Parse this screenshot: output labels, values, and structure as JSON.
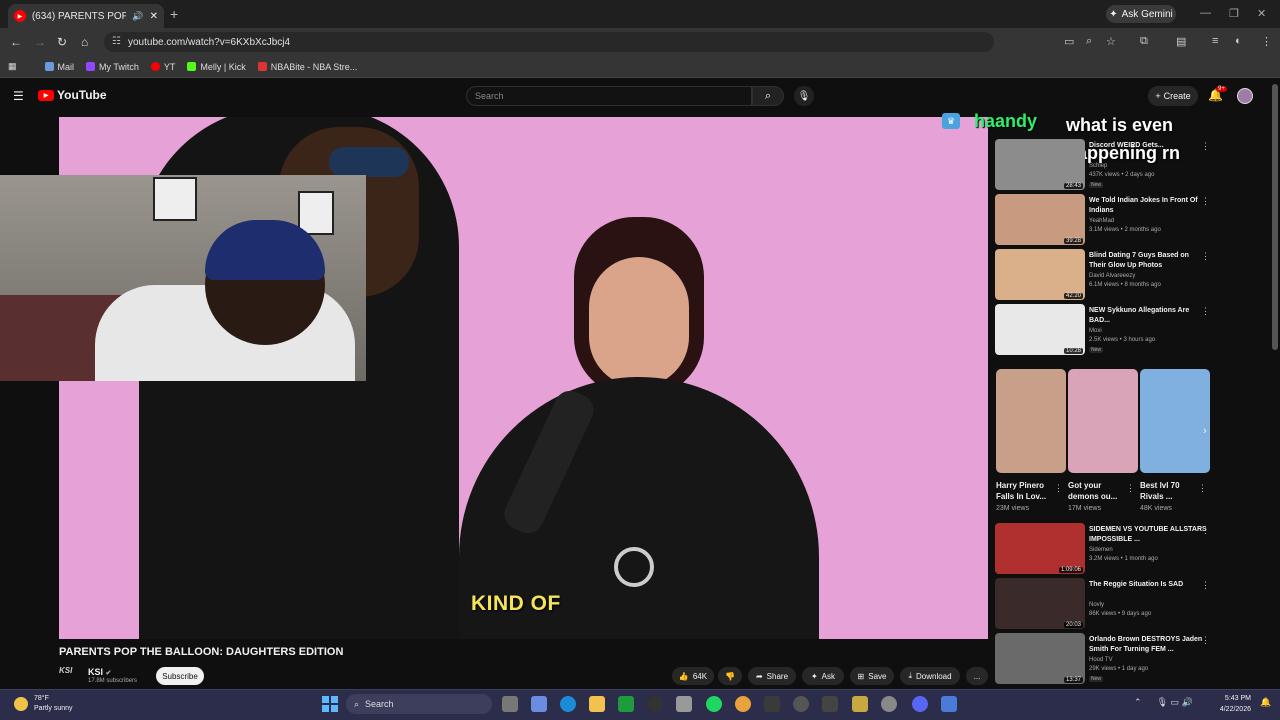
{
  "browser": {
    "tab_title": "(634) PARENTS POP THE BA",
    "new_tab": "+",
    "gemini": "Ask Gemini",
    "url": "youtube.com/watch?v=6KXbXcJbcj4",
    "bookmarks": [
      "Mail",
      "My Twitch",
      "YT",
      "Melly | Kick",
      "NBABite - NBA Stre..."
    ]
  },
  "youtube": {
    "logo": "YouTube",
    "search_placeholder": "Search",
    "create": "Create",
    "notif_count": "9+"
  },
  "video": {
    "caption": "KIND OF",
    "title": "PARENTS POP THE BALLOON: DAUGHTERS EDITION",
    "channel_logo": "KSI",
    "channel": "KSI",
    "subs": "17.8M subscribers",
    "subscribe": "Subscribe",
    "likes": "64K",
    "share": "Share",
    "ask": "Ask",
    "save": "Save",
    "download": "Download",
    "more": "..."
  },
  "chat": {
    "name": "haandy",
    "message": "what is even happening rn"
  },
  "recommendations": [
    {
      "title": "Discord WEIRD Gets...",
      "channel": "Schlep",
      "meta": "437K views • 2 days ago",
      "badge": "New",
      "dur": "28:43",
      "color": "#8c8c8c"
    },
    {
      "title": "We Told Indian Jokes In Front Of Indians",
      "channel": "YeahMad",
      "meta": "3.1M views • 2 months ago",
      "badge": "",
      "dur": "39:28",
      "color": "#c89a80"
    },
    {
      "title": "Blind Dating 7 Guys Based on Their Glow Up Photos",
      "channel": "David Alvareeezy",
      "meta": "6.1M views • 8 months ago",
      "badge": "",
      "dur": "42:20",
      "color": "#d9b08a"
    },
    {
      "title": "NEW Sykkuno Allegations Are BAD...",
      "channel": "Moxi",
      "meta": "2.5K views • 3 hours ago",
      "badge": "New",
      "dur": "10:28",
      "color": "#e8e8e8"
    }
  ],
  "shorts": [
    {
      "title": "Harry Pinero Falls In Lov...",
      "views": "23M views",
      "color": "#c8a08a"
    },
    {
      "title": "Got your demons ou...",
      "views": "17M views",
      "color": "#d9a3b8"
    },
    {
      "title": "Best lvl 70 Rivals ...",
      "views": "48K views",
      "color": "#7fb0e0"
    }
  ],
  "recommendations2": [
    {
      "title": "SIDEMEN VS YOUTUBE ALLSTARS IMPOSSIBLE ...",
      "channel": "Sidemen",
      "meta": "3.2M views • 1 month ago",
      "badge": "",
      "dur": "1:09:06",
      "color": "#b03030"
    },
    {
      "title": "The Reggie Situation Is SAD",
      "channel": "Novly",
      "meta": "86K views • 9 days ago",
      "badge": "",
      "dur": "20:03",
      "color": "#3a2a2a"
    },
    {
      "title": "Orlando Brown DESTROYS Jaden Smith For Turning FEM ...",
      "channel": "Hood TV",
      "meta": "29K views • 1 day ago",
      "badge": "New",
      "dur": "13:37",
      "color": "#6a6a6a"
    }
  ],
  "taskbar": {
    "temp": "78°F",
    "weather": "Partly sunny",
    "search": "Search",
    "time": "5:43 PM",
    "date": "4/22/2026"
  }
}
